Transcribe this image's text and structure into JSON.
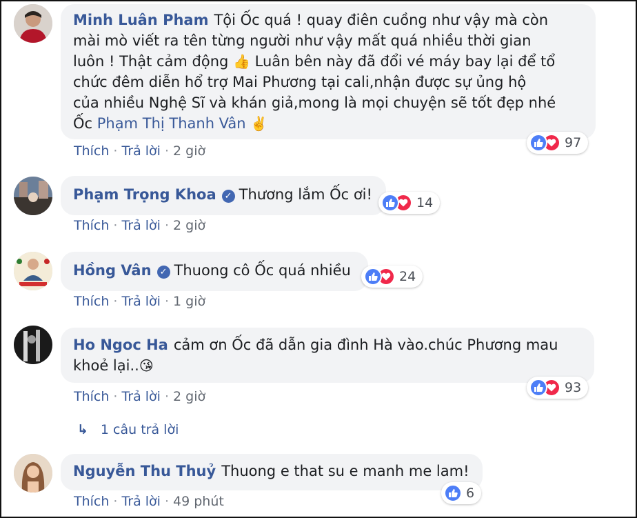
{
  "comments": [
    {
      "author": "Minh Luân Pham",
      "verified": false,
      "text_lines": [
        "Tội Ốc quá ! quay điên cuồng như vậy mà còn",
        "mài mò viết ra tên từng người như vậy mất quá nhiều thời gian",
        "luôn ! Thật cảm động",
        "chức đêm diễn hổ trợ Mai Phương tại cali,nhận được sự ủng hộ",
        "của nhiều Nghệ Sĩ và khán giả,mong là mọi chuyện sẽ tốt đẹp nhé",
        "Ốc"
      ],
      "text_line3_rest": " Luân bên này đã đổi vé máy bay lại để tổ",
      "mention": "Phạm Thị Thanh Vân",
      "emoji_1": "👍",
      "emoji_2": "✌️",
      "like_label": "Thích",
      "reply_label": "Trả lời",
      "time": "2 giờ",
      "reaction_count": "97"
    },
    {
      "author": "Phạm Trọng Khoa",
      "verified": true,
      "text": "Thương lắm Ốc ơi!",
      "like_label": "Thích",
      "reply_label": "Trả lời",
      "time": "2 giờ",
      "reaction_count": "14"
    },
    {
      "author": "Hồng Vân",
      "verified": true,
      "text": "Thuong cô Ốc quá nhiều",
      "like_label": "Thích",
      "reply_label": "Trả lời",
      "time": "1 giờ",
      "reaction_count": "24"
    },
    {
      "author": "Ho Ngoc Ha",
      "verified": false,
      "text_line1": "cảm ơn Ốc đã dẫn gia đình Hà vào.chúc Phương mau",
      "text_line2": "khoẻ lại..",
      "emoji": "😘",
      "like_label": "Thích",
      "reply_label": "Trả lời",
      "time": "2 giờ",
      "reaction_count": "93",
      "replies_label": "1 câu trả lời"
    },
    {
      "author": "Nguyễn Thu Thuỷ",
      "verified": false,
      "text": "Thuong e that su e manh me lam!",
      "like_label": "Thích",
      "reply_label": "Trả lời",
      "time": "49 phút",
      "reaction_count": "6"
    }
  ],
  "icons": {
    "reply_arrow": "↳",
    "like": "thumbs-up-icon",
    "love": "heart-icon",
    "verified": "✓"
  },
  "colors": {
    "link": "#385898",
    "bubble": "#f2f3f5",
    "like": "#4d7ef7",
    "love": "#f0284a"
  }
}
